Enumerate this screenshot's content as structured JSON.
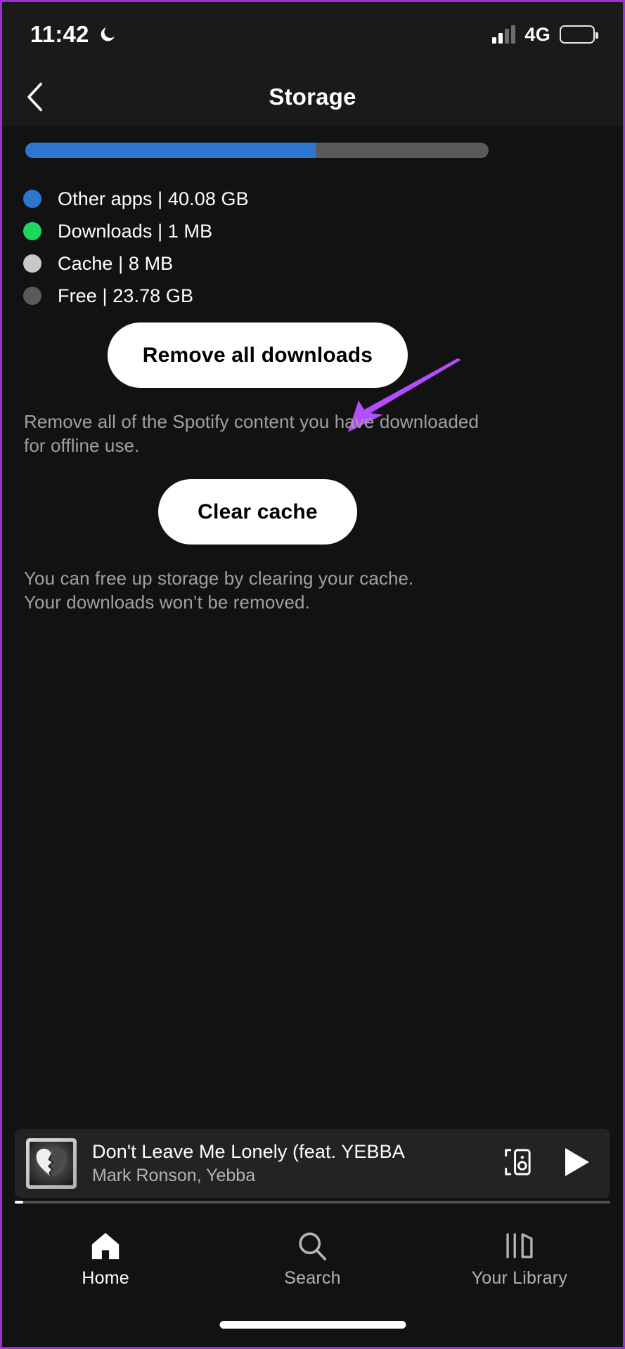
{
  "status_bar": {
    "time": "11:42",
    "dnd_icon": "moon-icon",
    "network": "4G",
    "signal_icon": "signal-bars-icon",
    "battery_icon": "battery-icon"
  },
  "header": {
    "title": "Storage",
    "back_icon": "chevron-left-icon"
  },
  "storage": {
    "bar_used_percent": 62.6,
    "legend": [
      {
        "label": "Other apps | 40.08 GB",
        "color": "#2e77d0",
        "name": "other-apps"
      },
      {
        "label": "Downloads | 1 MB",
        "color": "#1ed75f",
        "name": "downloads"
      },
      {
        "label": "Cache | 8 MB",
        "color": "#c8c8c8",
        "name": "cache"
      },
      {
        "label": "Free | 23.78 GB",
        "color": "#5a5a5a",
        "name": "free"
      }
    ]
  },
  "actions": {
    "remove_downloads_label": "Remove all downloads",
    "remove_downloads_desc": "Remove all of the Spotify content you have downloaded for offline use.",
    "clear_cache_label": "Clear cache",
    "clear_cache_desc": "You can free up storage by clearing your cache. Your downloads won’t be removed."
  },
  "annotation": {
    "type": "arrow",
    "color": "#b34dff",
    "points_to": "Remove all downloads"
  },
  "now_playing": {
    "title": "Don't Leave Me Lonely (feat. YEBBA",
    "artist": "Mark Ronson, Yebba",
    "artwork_icon": "broken-heart-album-art",
    "connect_icon": "spotify-connect-icon",
    "play_icon": "play-icon",
    "progress_percent": 1.4
  },
  "tabs": [
    {
      "label": "Home",
      "icon": "home-icon",
      "active": true
    },
    {
      "label": "Search",
      "icon": "search-icon",
      "active": false
    },
    {
      "label": "Your Library",
      "icon": "library-icon",
      "active": false
    }
  ],
  "colors": {
    "background": "#121212",
    "surface": "#1a1a1a",
    "accent_blue": "#2e77d0",
    "accent_green": "#1ed75f",
    "annotation_purple": "#b34dff"
  }
}
